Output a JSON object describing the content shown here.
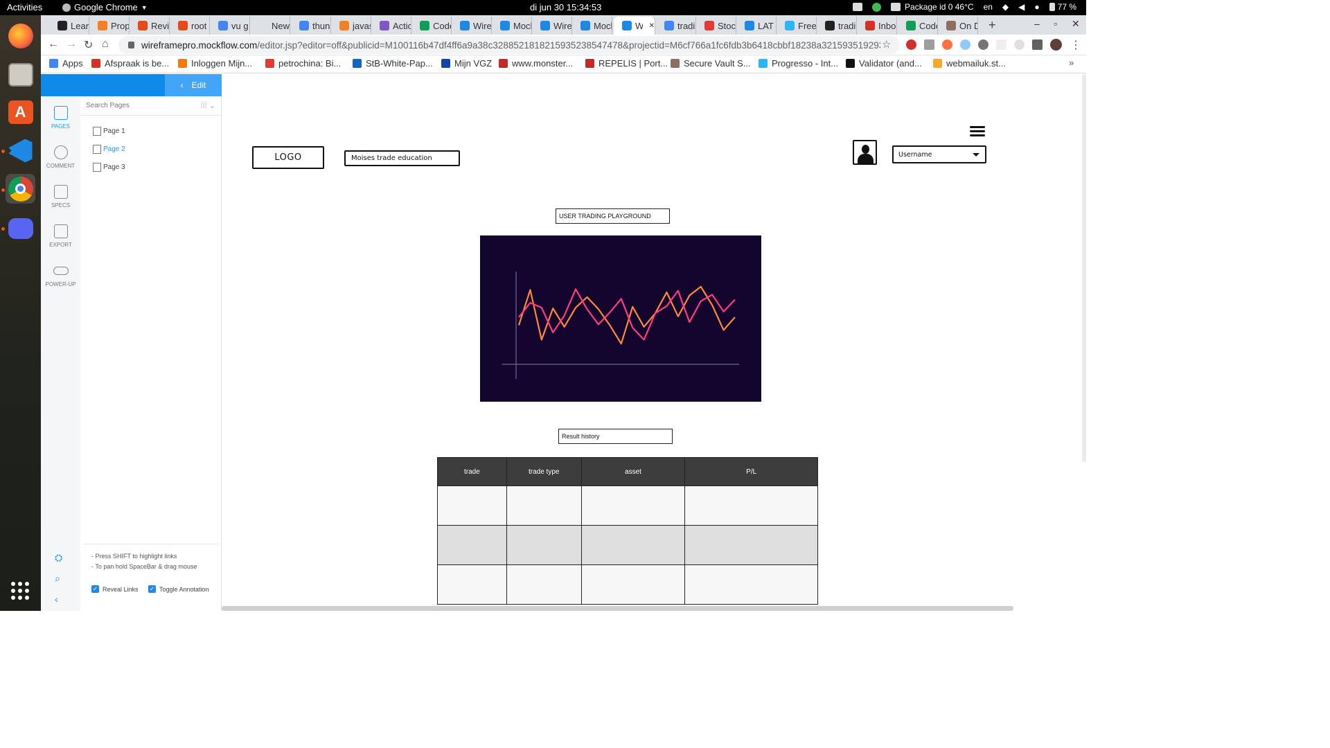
{
  "system": {
    "activities": "Activities",
    "app_name": "Google Chrome",
    "clock": "di jun 30  15:34:53",
    "package_status": "Package id 0 46°C",
    "language": "en",
    "battery": "77 %"
  },
  "dock": {
    "items": [
      "firefox-icon",
      "files-icon",
      "software-icon",
      "vscode-icon",
      "chrome-icon",
      "discord-icon"
    ]
  },
  "tabs": [
    {
      "label": "Lear",
      "color": "#222"
    },
    {
      "label": "Prop",
      "color": "#f48024"
    },
    {
      "label": "Revi",
      "color": "#e64a19"
    },
    {
      "label": "root",
      "color": "#e64a19"
    },
    {
      "label": "vu g",
      "color": "#4285f4"
    },
    {
      "label": "New Tal",
      "color": "#dee1e6"
    },
    {
      "label": "thun",
      "color": "#4285f4"
    },
    {
      "label": "javas",
      "color": "#f48024"
    },
    {
      "label": "Actio",
      "color": "#7e57c2"
    },
    {
      "label": "Code",
      "color": "#0f9d58"
    },
    {
      "label": "Wire",
      "color": "#1e88e5"
    },
    {
      "label": "Mocl",
      "color": "#1e88e5"
    },
    {
      "label": "Wire",
      "color": "#1e88e5"
    },
    {
      "label": "Mocl",
      "color": "#1e88e5"
    },
    {
      "label": "W",
      "color": "#1e88e5"
    },
    {
      "label": "tradi",
      "color": "#4285f4"
    },
    {
      "label": "Stoc",
      "color": "#e53935"
    },
    {
      "label": "LAT",
      "color": "#1e88e5"
    },
    {
      "label": "Free",
      "color": "#29b6f6"
    },
    {
      "label": "tradi",
      "color": "#222"
    },
    {
      "label": "Inbo",
      "color": "#d93025"
    },
    {
      "label": "Code",
      "color": "#0f9d58"
    },
    {
      "label": "On D",
      "color": "#8d6e63"
    }
  ],
  "omnibox": {
    "host": "wireframepro.mockflow.com",
    "path": "/editor.jsp?editor=off&publicid=M100116b47df4ff6a9a38c3288521818215935238547478&projectid=M6cf766a1fc6fdb3b6418cbbf18238a32159351929346&perm=Owner#/..."
  },
  "bookmarks": [
    {
      "label": "Apps",
      "color": "#4285f4"
    },
    {
      "label": "Afspraak is be...",
      "color": "#d93025"
    },
    {
      "label": "Inloggen Mijn...",
      "color": "#f57c00"
    },
    {
      "label": "petrochina: Bi...",
      "color": "#e53935"
    },
    {
      "label": "StB-White-Pap...",
      "color": "#1565c0"
    },
    {
      "label": "Mijn VGZ",
      "color": "#0d47a1"
    },
    {
      "label": "www.monster...",
      "color": "#c62828"
    },
    {
      "label": "REPELIS | Port...",
      "color": "#c62828"
    },
    {
      "label": "Secure Vault S...",
      "color": "#8d6e63"
    },
    {
      "label": "Progresso - Int...",
      "color": "#29b6f6"
    },
    {
      "label": "Validator (and...",
      "color": "#111"
    },
    {
      "label": "webmailuk.st...",
      "color": "#f9a825"
    }
  ],
  "mockflow": {
    "edit_label": "Edit",
    "rail": [
      "PAGES",
      "COMMENT",
      "SPECS",
      "EXPORT",
      "POWER-UP"
    ],
    "search_placeholder": "Search Pages",
    "pages": [
      "Page 1",
      "Page 2",
      "Page 3"
    ],
    "active_page": "Page 2",
    "hints": [
      "- Press SHIFT to highlight links",
      "- To pan hold SpaceBar & drag mouse"
    ],
    "reveal_links": "Reveal Links",
    "toggle_annotation": "Toggle Annotation"
  },
  "wireframe": {
    "logo": "LOGO",
    "site_title": "Moises trade education",
    "username": "Username",
    "playground_label": "USER TRADING PLAYGROUND",
    "history_label": "Result history",
    "table": {
      "columns": [
        "trade",
        "trade type",
        "asset",
        "P/L"
      ],
      "rows": [
        [
          "",
          "",
          "",
          ""
        ],
        [
          "",
          "",
          "",
          ""
        ],
        [
          "",
          "",
          "",
          ""
        ]
      ]
    }
  },
  "chart_data": {
    "type": "line",
    "title": "",
    "background": "#13052e",
    "axis_color": "#5b5d8a",
    "ylim": [
      0,
      100
    ],
    "x": [
      0,
      1,
      2,
      3,
      4,
      5,
      6,
      7,
      8,
      9,
      10,
      11,
      12,
      13,
      14,
      15,
      16,
      17,
      18,
      19
    ],
    "series": [
      {
        "color": "#ff8a3d",
        "values": [
          40,
          84,
          22,
          61,
          38,
          62,
          75,
          60,
          40,
          17,
          63,
          38,
          55,
          81,
          51,
          77,
          88,
          65,
          34,
          50
        ]
      },
      {
        "color": "#ff3d7f",
        "values": [
          50,
          68,
          62,
          31,
          52,
          85,
          60,
          41,
          56,
          73,
          37,
          22,
          55,
          64,
          83,
          44,
          70,
          78,
          57,
          72
        ]
      }
    ]
  }
}
